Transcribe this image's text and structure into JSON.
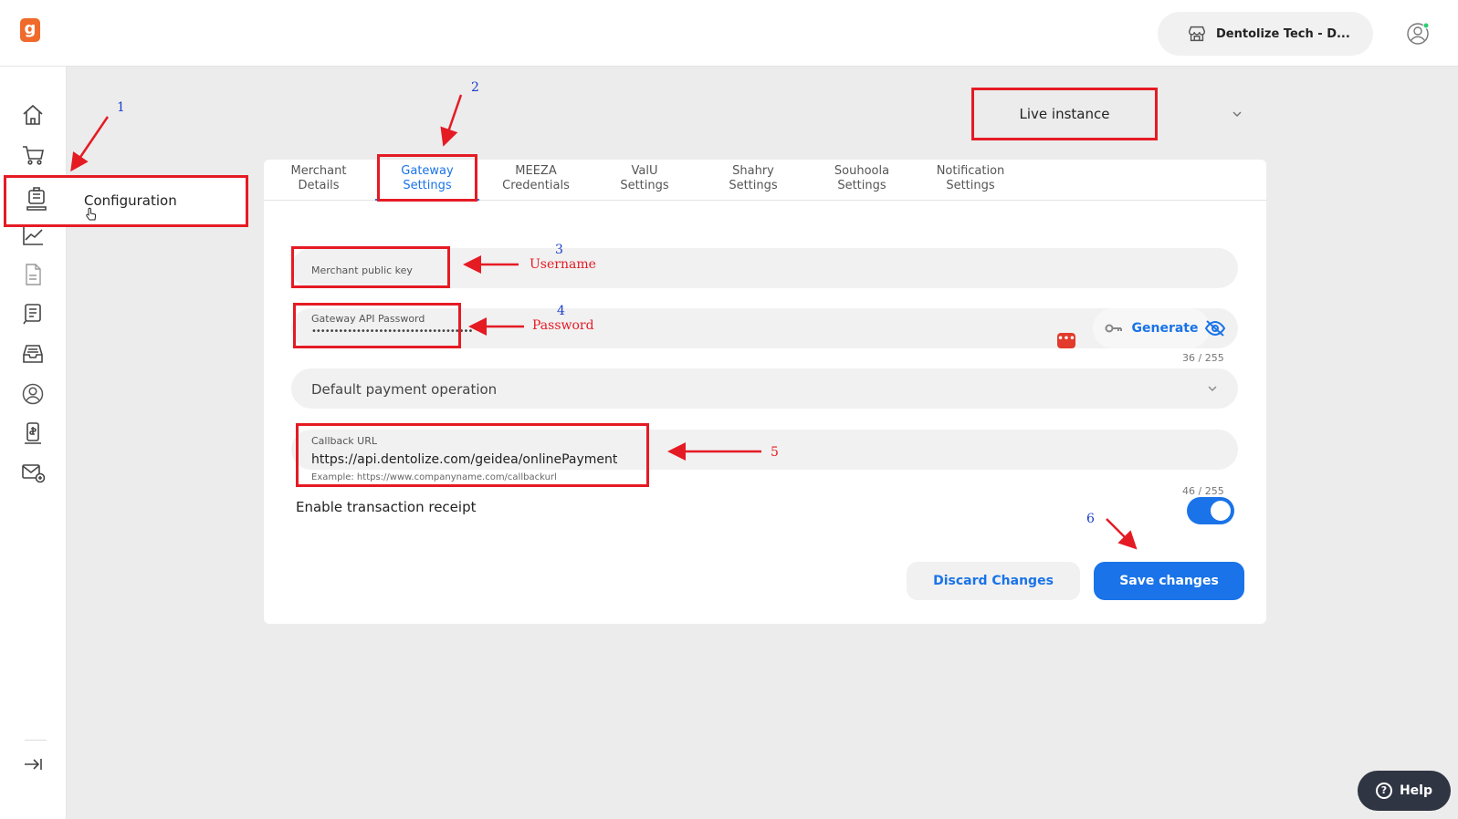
{
  "topbar": {
    "merchant_name": "Dentolize Tech - D...",
    "merchant_icon": "storefront-icon",
    "user_icon": "user-avatar-icon",
    "logo": "g"
  },
  "sidebar": {
    "icons": [
      "home-icon",
      "cart-icon",
      "configuration-icon",
      "analytics-icon",
      "document-icon",
      "invoice-icon",
      "inbox-icon",
      "customer-icon",
      "payment-link-icon",
      "email-icon"
    ],
    "collapse_icon": "expand-arrow-icon",
    "tooltip_label": "Configuration"
  },
  "instance": {
    "label": "Live instance"
  },
  "tabs": [
    {
      "label": "Merchant\nDetails",
      "active": false
    },
    {
      "label": "Gateway\nSettings",
      "active": true
    },
    {
      "label": "MEEZA\nCredentials",
      "active": false
    },
    {
      "label": "ValU\nSettings",
      "active": false
    },
    {
      "label": "Shahry\nSettings",
      "active": false
    },
    {
      "label": "Souhoola\nSettings",
      "active": false
    },
    {
      "label": "Notification\nSettings",
      "active": false
    }
  ],
  "form": {
    "public_key_label": "Merchant public key",
    "password_label": "Gateway API Password",
    "password_value": "••••••••••••••••••••••••••••••••••••",
    "password_counter": "36 / 255",
    "password_badge": "•••",
    "generate_label": "Generate",
    "payment_operation_placeholder": "Default payment operation",
    "callback_label": "Callback URL",
    "callback_value": "https://api.dentolize.com/geidea/onlinePayment",
    "callback_hint": "Example: https://www.companyname.com/callbackurl",
    "callback_counter": "46 / 255",
    "receipt_label": "Enable transaction receipt",
    "receipt_enabled": true
  },
  "actions": {
    "discard_label": "Discard Changes",
    "save_label": "Save changes"
  },
  "help": {
    "label": "Help",
    "glyph": "?"
  },
  "annotations": {
    "n1": "1",
    "n2": "2",
    "n3": "3",
    "n4": "4",
    "n5": "5",
    "n6": "6",
    "username": "Username",
    "password": "Password",
    "color_box": "#e51b24",
    "color_number": "#1a3fc9"
  },
  "colors": {
    "accent": "#1a73e8",
    "logo": "#ef6a2b",
    "background": "#ececec"
  }
}
